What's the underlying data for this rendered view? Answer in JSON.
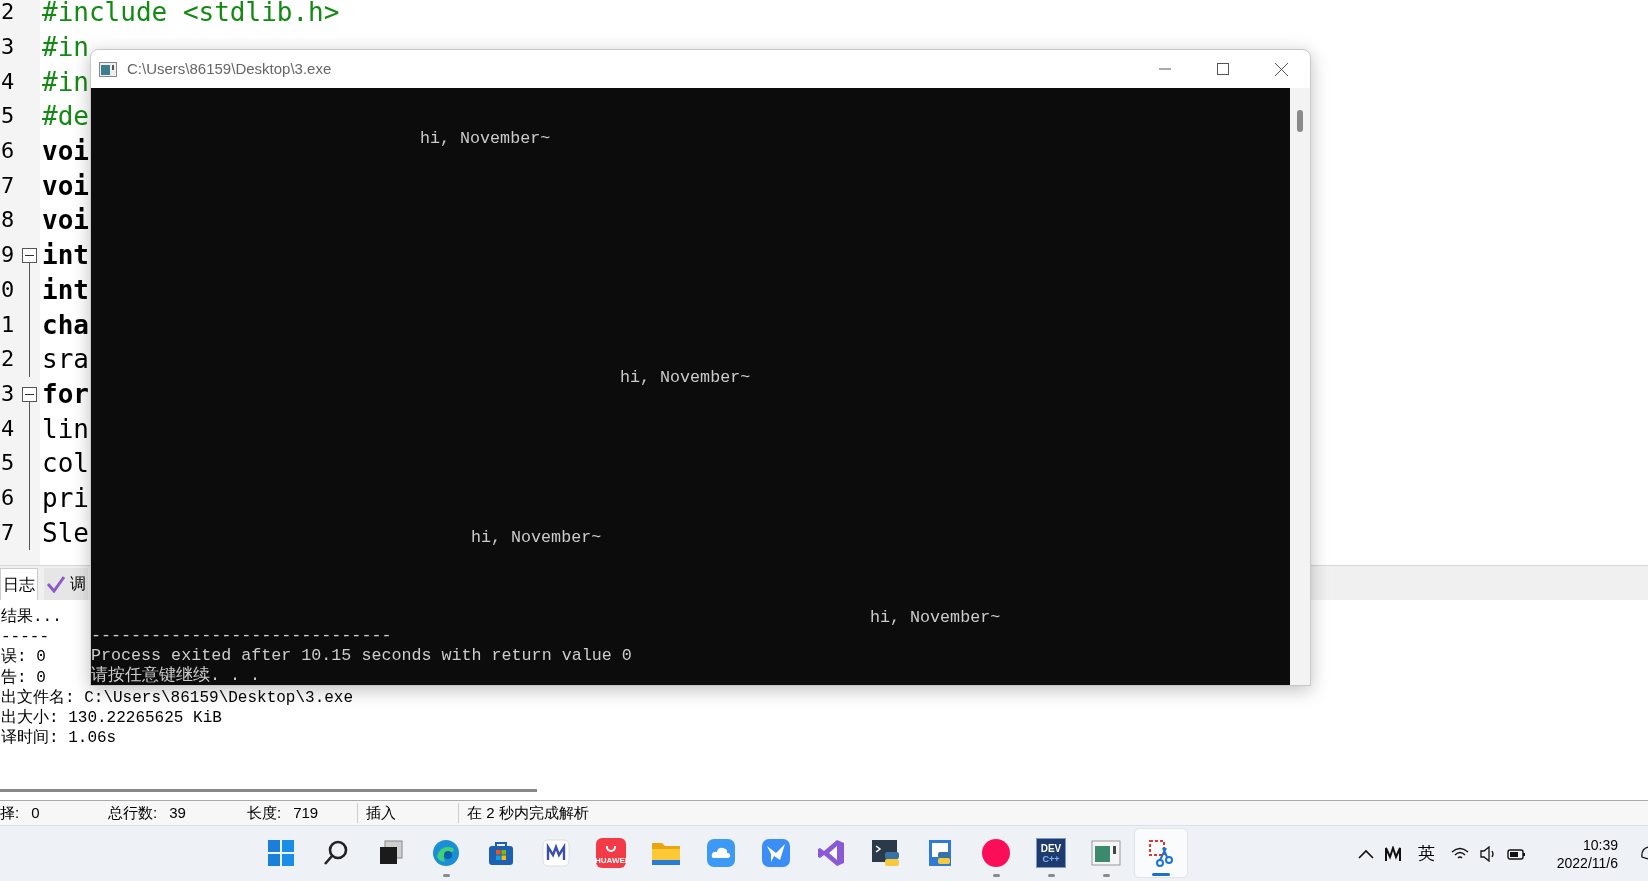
{
  "editor": {
    "lines": [
      {
        "number": "2",
        "text": "#include <stdlib.h>",
        "kind": "directive",
        "fold_box": false,
        "fold_line": false
      },
      {
        "number": "3",
        "text": "#in",
        "kind": "directive",
        "fold_box": false,
        "fold_line": false
      },
      {
        "number": "4",
        "text": "#in",
        "kind": "directive",
        "fold_box": false,
        "fold_line": false
      },
      {
        "number": "5",
        "text": "#de",
        "kind": "directive",
        "fold_box": false,
        "fold_line": false
      },
      {
        "number": "6",
        "text": "voi",
        "kind": "keyword",
        "fold_box": false,
        "fold_line": false
      },
      {
        "number": "7",
        "text": "voi",
        "kind": "keyword",
        "fold_box": false,
        "fold_line": false
      },
      {
        "number": "8",
        "text": "voi",
        "kind": "keyword",
        "fold_box": false,
        "fold_line": false
      },
      {
        "number": "9",
        "text": "int",
        "kind": "keyword",
        "fold_box": true,
        "fold_line": false
      },
      {
        "number": "0",
        "text": "int",
        "kind": "keyword",
        "fold_box": false,
        "fold_line": true
      },
      {
        "number": "1",
        "text": "cha",
        "kind": "keyword",
        "fold_box": false,
        "fold_line": true
      },
      {
        "number": "2",
        "text": "sra",
        "kind": "plain",
        "fold_box": false,
        "fold_line": true
      },
      {
        "number": "3",
        "text": "for",
        "kind": "keyword",
        "fold_box": true,
        "fold_line": false
      },
      {
        "number": "4",
        "text": "lin",
        "kind": "plain",
        "fold_box": false,
        "fold_line": true
      },
      {
        "number": "5",
        "text": "col",
        "kind": "plain",
        "fold_box": false,
        "fold_line": true
      },
      {
        "number": "6",
        "text": "pri",
        "kind": "plain",
        "fold_box": false,
        "fold_line": true
      },
      {
        "number": "7",
        "text": "Sle",
        "kind": "plain",
        "fold_box": false,
        "fold_line": true
      }
    ]
  },
  "bottom_tabs": [
    {
      "label": "日志",
      "selected": true,
      "kind": "plain"
    },
    {
      "label": "调",
      "selected": false,
      "kind": "check"
    }
  ],
  "log": [
    "结果...",
    "-----",
    "误: 0",
    "告: 0",
    "出文件名: C:\\Users\\86159\\Desktop\\3.exe",
    "出大小: 130.22265625 KiB",
    "译时间: 1.06s"
  ],
  "status_bar": [
    {
      "label": "择:",
      "value": "0"
    },
    {
      "label": "总行数:",
      "value": "39"
    },
    {
      "label": "长度:",
      "value": "719"
    },
    {
      "text": "插入"
    },
    {
      "text": "在 2 秒内完成解析"
    }
  ],
  "console": {
    "title": "C:\\Users\\86159\\Desktop\\3.exe",
    "echoes": [
      "hi, November~",
      "hi, November~",
      "hi, November~",
      "hi, November~"
    ],
    "output": [
      "------------------------------",
      "Process exited after 10.15 seconds with return value 0",
      "请按任意键继续. . ."
    ]
  },
  "taskbar": {
    "apps": [
      {
        "kind": "start",
        "running": false,
        "selected": false
      },
      {
        "kind": "search",
        "running": false,
        "selected": false
      },
      {
        "kind": "taskview",
        "running": false,
        "selected": false
      },
      {
        "kind": "edge",
        "running": true,
        "selected": false
      },
      {
        "kind": "store",
        "running": false,
        "selected": false
      },
      {
        "kind": "mapp",
        "running": false,
        "selected": false
      },
      {
        "kind": "huawei",
        "label": "HUAWEI",
        "running": false,
        "selected": false
      },
      {
        "kind": "folder",
        "running": false,
        "selected": false
      },
      {
        "kind": "cloud",
        "running": false,
        "selected": false
      },
      {
        "kind": "bird",
        "running": false,
        "selected": false
      },
      {
        "kind": "vs",
        "running": false,
        "selected": false
      },
      {
        "kind": "pyterm",
        "running": false,
        "selected": false
      },
      {
        "kind": "pydoc",
        "running": false,
        "selected": false
      },
      {
        "kind": "record",
        "running": true,
        "selected": false
      },
      {
        "kind": "dev",
        "label": "DEV",
        "sublabel": "C++",
        "running": true,
        "selected": false
      },
      {
        "kind": "console",
        "running": true,
        "selected": false
      },
      {
        "kind": "snip",
        "running": true,
        "selected": true
      }
    ],
    "tray": {
      "ime": "英",
      "time": "10:39",
      "date": "2022/11/6"
    }
  }
}
